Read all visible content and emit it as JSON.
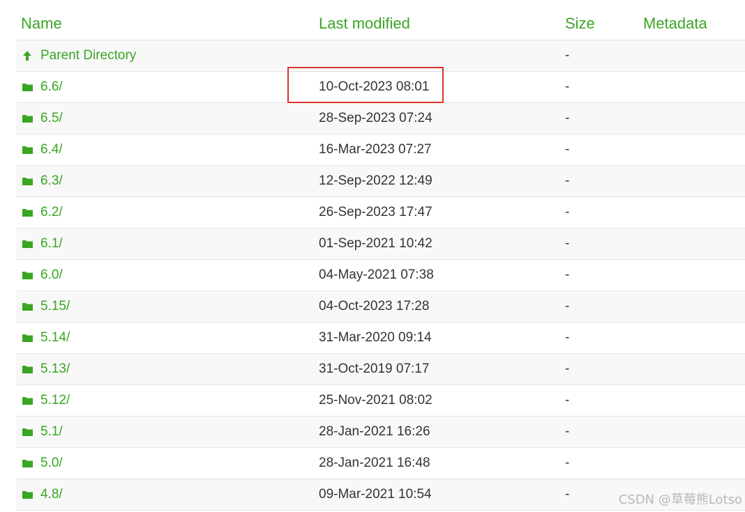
{
  "columns": {
    "name": "Name",
    "last_modified": "Last modified",
    "size": "Size",
    "metadata": "Metadata"
  },
  "parent": {
    "label": "Parent Directory",
    "size": "-"
  },
  "rows": [
    {
      "name": "6.6/",
      "modified": "10-Oct-2023 08:01",
      "size": "-"
    },
    {
      "name": "6.5/",
      "modified": "28-Sep-2023 07:24",
      "size": "-"
    },
    {
      "name": "6.4/",
      "modified": "16-Mar-2023 07:27",
      "size": "-"
    },
    {
      "name": "6.3/",
      "modified": "12-Sep-2022 12:49",
      "size": "-"
    },
    {
      "name": "6.2/",
      "modified": "26-Sep-2023 17:47",
      "size": "-"
    },
    {
      "name": "6.1/",
      "modified": "01-Sep-2021 10:42",
      "size": "-"
    },
    {
      "name": "6.0/",
      "modified": "04-May-2021 07:38",
      "size": "-"
    },
    {
      "name": "5.15/",
      "modified": "04-Oct-2023 17:28",
      "size": "-"
    },
    {
      "name": "5.14/",
      "modified": "31-Mar-2020 09:14",
      "size": "-"
    },
    {
      "name": "5.13/",
      "modified": "31-Oct-2019 07:17",
      "size": "-"
    },
    {
      "name": "5.12/",
      "modified": "25-Nov-2021 08:02",
      "size": "-"
    },
    {
      "name": "5.1/",
      "modified": "28-Jan-2021 16:26",
      "size": "-"
    },
    {
      "name": "5.0/",
      "modified": "28-Jan-2021 16:48",
      "size": "-"
    },
    {
      "name": "4.8/",
      "modified": "09-Mar-2021 10:54",
      "size": "-"
    }
  ],
  "watermark": "CSDN @草莓熊Lotso",
  "icons": {
    "parent": "arrow-up-icon",
    "folder": "folder-icon"
  },
  "colors": {
    "accent": "#3aa523",
    "highlight": "#d9352a",
    "text": "#333333"
  }
}
